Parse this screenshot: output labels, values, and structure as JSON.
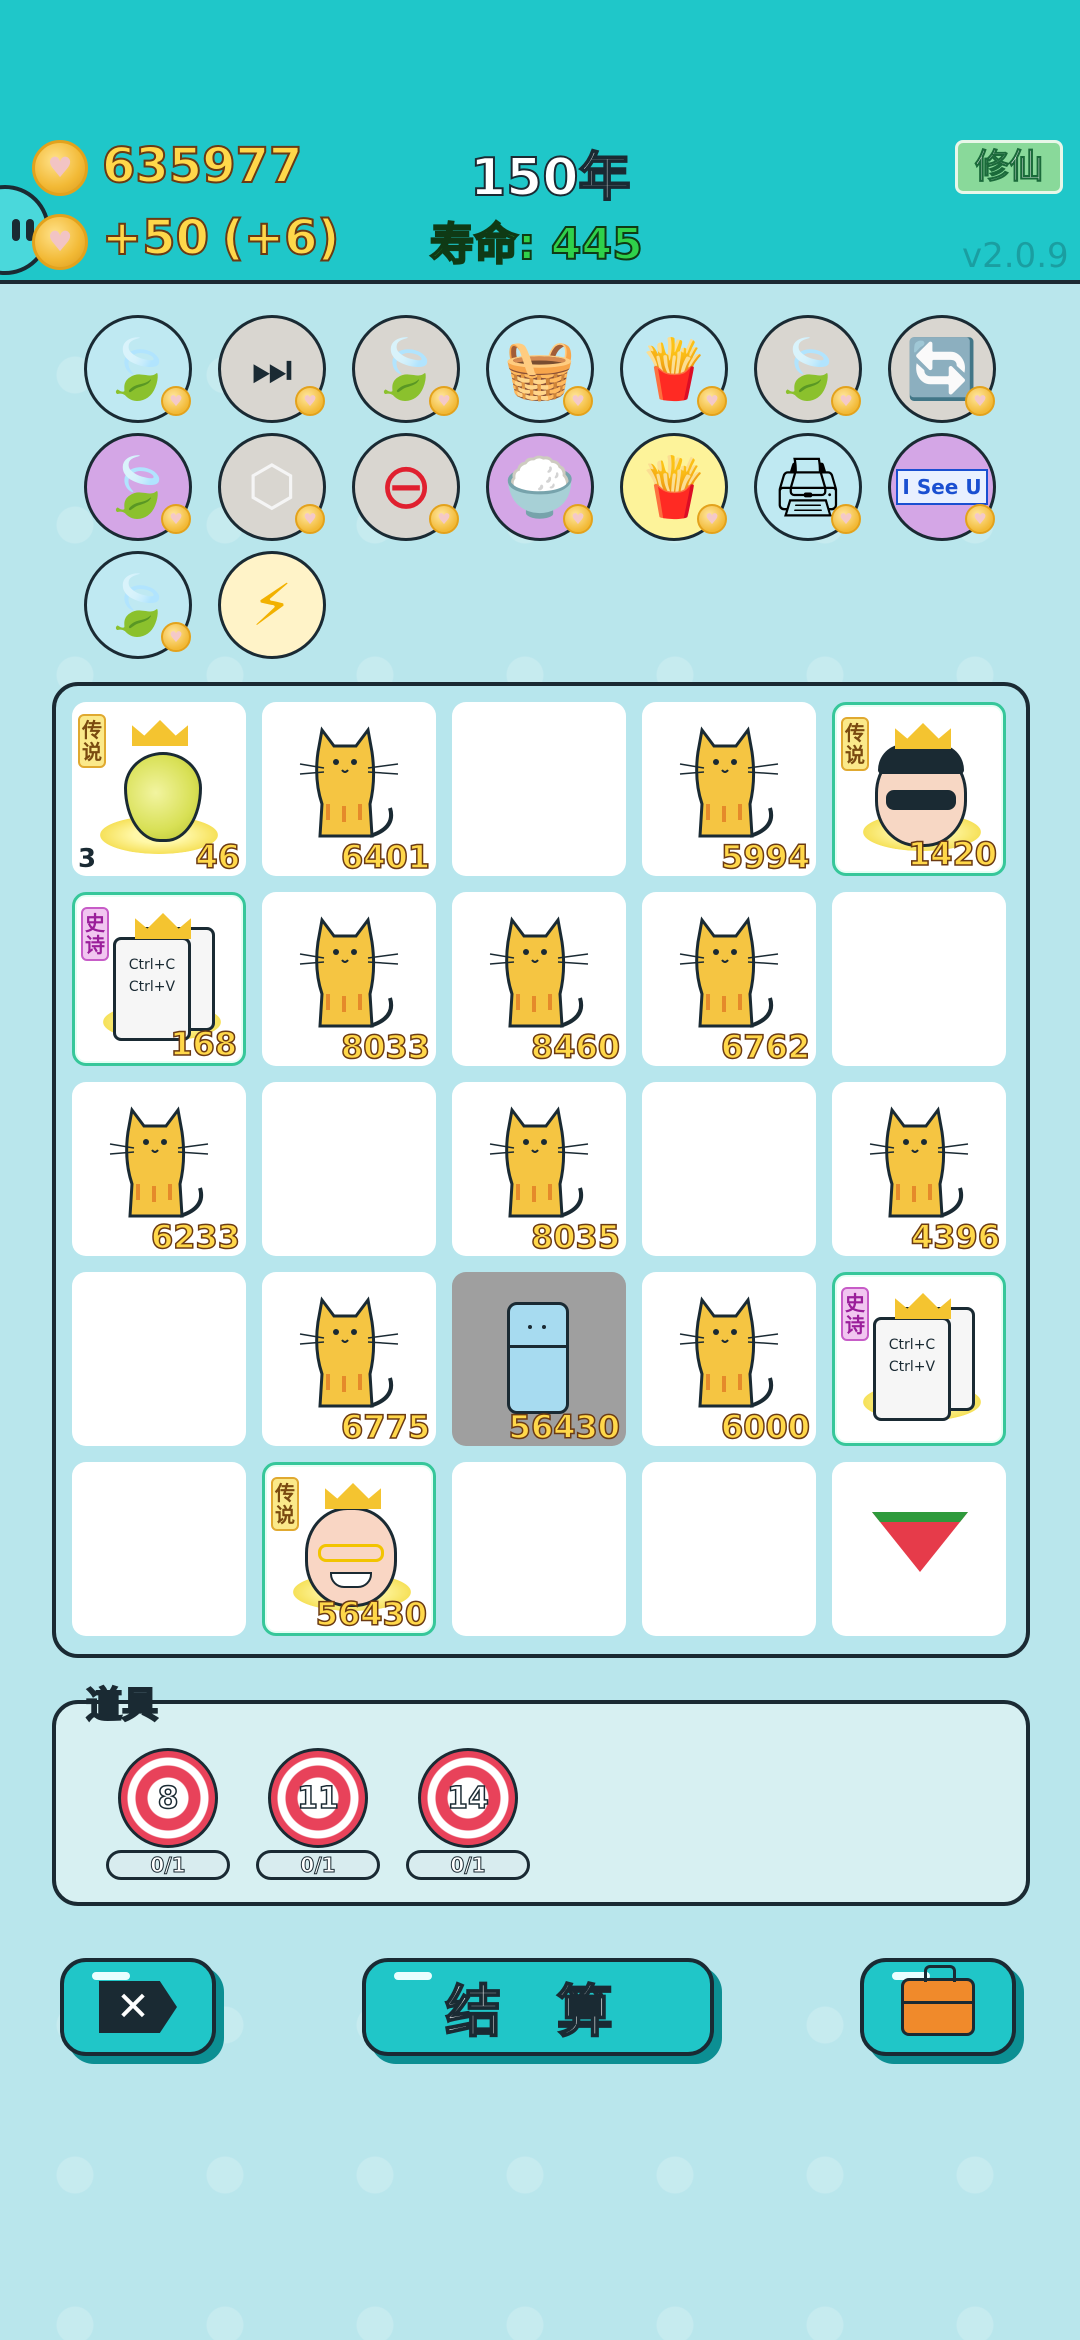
{
  "header": {
    "coins": "635977",
    "income": "+50",
    "income_bonus": "(+6)",
    "year": "150年",
    "lifespan": "寿命: 445",
    "cultivate_button": "修仙",
    "version": "v2.0.9"
  },
  "relics": [
    {
      "icon": "leaf-icon",
      "bg": "blue"
    },
    {
      "icon": "skip-icon",
      "bg": "gray"
    },
    {
      "icon": "leaf-icon",
      "bg": "gray"
    },
    {
      "icon": "fruit-basket-icon",
      "bg": "blue"
    },
    {
      "icon": "fries-icon",
      "bg": "blue"
    },
    {
      "icon": "leaf-icon",
      "bg": "gray"
    },
    {
      "icon": "refresh-icon",
      "bg": "gray"
    },
    {
      "icon": "leaf-icon",
      "bg": "purple"
    },
    {
      "icon": "dice-icon",
      "bg": "gray"
    },
    {
      "icon": "minus-circle-icon",
      "bg": "gray"
    },
    {
      "icon": "rice-bowl-icon",
      "bg": "purple"
    },
    {
      "icon": "fries-icon",
      "bg": "yellow"
    },
    {
      "icon": "printer-icon",
      "bg": "blue"
    },
    {
      "icon": "i-see-u-icon",
      "bg": "purple",
      "label": "I See U"
    },
    {
      "icon": "leaf-icon",
      "bg": "blue"
    },
    {
      "icon": "lightning-icon",
      "bg": "cream"
    }
  ],
  "board": {
    "cells": [
      {
        "item": "pear",
        "value": "46",
        "count": "3",
        "tag": "传说"
      },
      {
        "item": "cat",
        "value": "6401"
      },
      {
        "item": "empty",
        "value": ""
      },
      {
        "item": "cat",
        "value": "5994"
      },
      {
        "item": "sunglasses-man",
        "value": "1420",
        "tag": "传说"
      },
      {
        "item": "ctrl-card",
        "value": "168",
        "tag": "史诗",
        "card_text": [
          "Ctrl+C",
          "Ctrl+V"
        ]
      },
      {
        "item": "cat",
        "value": "8033"
      },
      {
        "item": "cat",
        "value": "8460"
      },
      {
        "item": "cat",
        "value": "6762"
      },
      {
        "item": "empty",
        "value": ""
      },
      {
        "item": "cat",
        "value": "6233"
      },
      {
        "item": "empty",
        "value": ""
      },
      {
        "item": "cat",
        "value": "8035"
      },
      {
        "item": "empty",
        "value": ""
      },
      {
        "item": "cat",
        "value": "4396"
      },
      {
        "item": "empty",
        "value": ""
      },
      {
        "item": "cat",
        "value": "6775"
      },
      {
        "item": "fridge",
        "value": "56430"
      },
      {
        "item": "cat",
        "value": "6000"
      },
      {
        "item": "ctrl-card",
        "value": "",
        "tag": "史诗",
        "card_text": [
          "Ctrl+C",
          "Ctrl+V"
        ]
      },
      {
        "item": "empty",
        "value": ""
      },
      {
        "item": "old-man",
        "value": "56430",
        "tag": "传说"
      },
      {
        "item": "empty",
        "value": ""
      },
      {
        "item": "empty",
        "value": ""
      },
      {
        "item": "watermelon",
        "value": ""
      }
    ]
  },
  "items": {
    "title": "道具",
    "list": [
      {
        "number": "8",
        "usage": "0/1"
      },
      {
        "number": "11",
        "usage": "0/1"
      },
      {
        "number": "14",
        "usage": "0/1"
      }
    ]
  },
  "buttons": {
    "settle": "结 算"
  },
  "colors": {
    "header_bg": "#1fc7c9",
    "body_bg": "#b9e6ec",
    "gold": "#ffd84a",
    "green_text": "#2fd14a",
    "highlight": "#36c79a"
  }
}
